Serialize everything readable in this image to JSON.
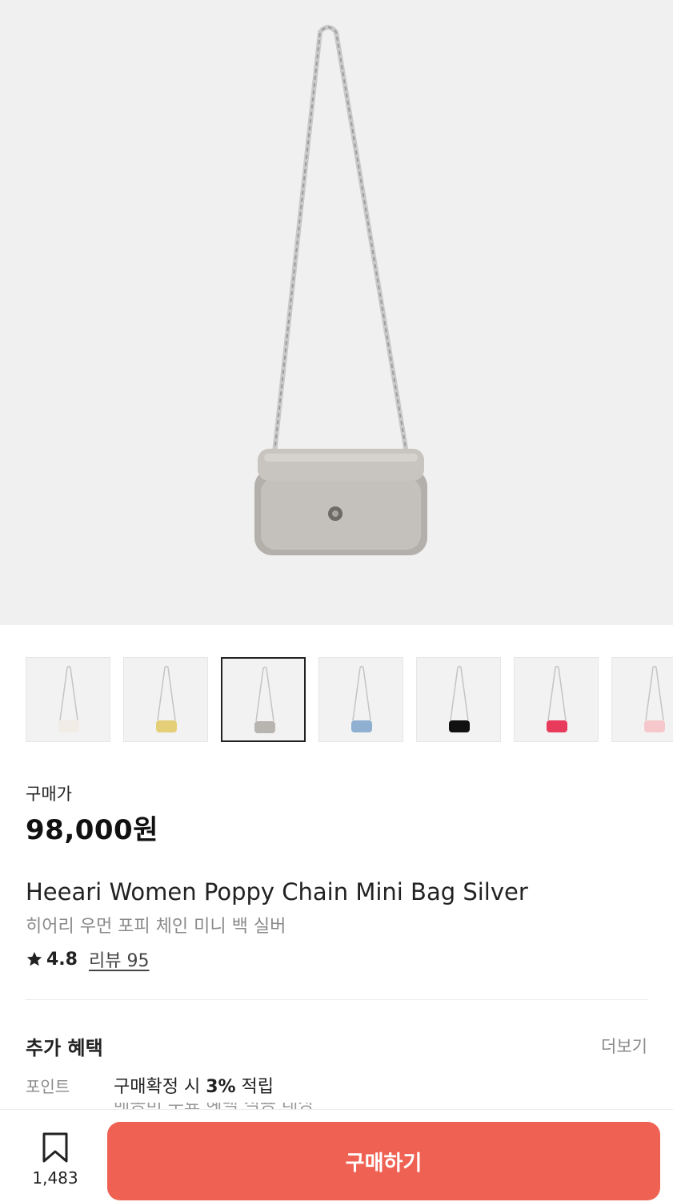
{
  "product": {
    "price_label": "구매가",
    "price": "98,000원",
    "name_en": "Heeari Women Poppy Chain Mini Bag Silver",
    "name_ko": "히어리 우먼 포피 체인 미니 백 실버",
    "rating": "4.8",
    "review_link": "리뷰 95",
    "image_icon": "chain-bag-image"
  },
  "thumbnails": [
    {
      "color": "#f1ece6",
      "selected": false
    },
    {
      "color": "#e4cf78",
      "selected": false
    },
    {
      "color": "#b8b4b0",
      "selected": true
    },
    {
      "color": "#8fb0d0",
      "selected": false
    },
    {
      "color": "#111111",
      "selected": false
    },
    {
      "color": "#e83a5a",
      "selected": false
    },
    {
      "color": "#f6c8cc",
      "selected": false
    }
  ],
  "benefits": {
    "title": "추가 혜택",
    "more": "더보기",
    "point_label": "포인트",
    "point_prefix": "구매확정 시 ",
    "point_value": "3%",
    "point_suffix": " 적립",
    "next_line_partial": "배송비 무료 혜택 적용 대상"
  },
  "bottom_bar": {
    "bookmark_count": "1,483",
    "buy_label": "구매하기",
    "buy_color": "#ef6253"
  }
}
